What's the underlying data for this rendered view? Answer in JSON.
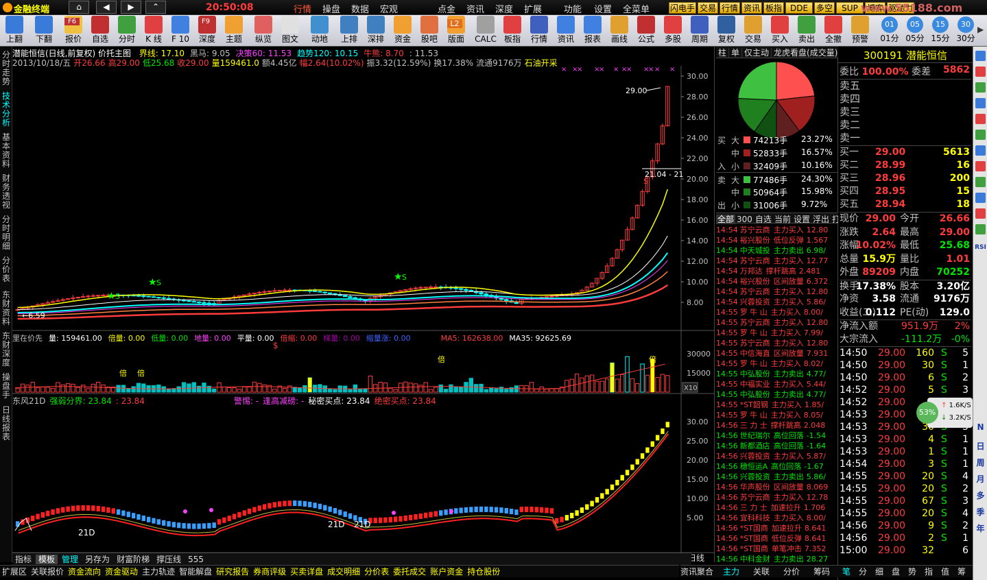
{
  "menubar": {
    "app_title": "金融终端",
    "clock": "20:50:08",
    "items": [
      "行情",
      "操盘",
      "数据",
      "宏观",
      "点金",
      "资讯",
      "深度",
      "扩展",
      "功能",
      "设置",
      "全菜单"
    ],
    "yellow_buttons": [
      "闪电手",
      "交易",
      "行情",
      "资讯",
      "板指",
      "DDE",
      "多空",
      "SUP",
      "博弈",
      "驱动力"
    ],
    "watermark": "www.55188.com"
  },
  "toolbar": {
    "buttons": [
      "上翻",
      "下翻",
      "报价",
      "自选",
      "分时",
      "K 线",
      "F 10",
      "深度",
      "主题",
      "纵览",
      "图文",
      "动地",
      "上排",
      "深排",
      "资金",
      "股吧",
      "版面",
      "CALC",
      "板指",
      "行情",
      "资讯",
      "报表",
      "画线",
      "公式",
      "多股",
      "周期",
      "复权",
      "交易",
      "买入",
      "卖出",
      "全撤",
      "预警"
    ],
    "periods": [
      "01",
      "05",
      "15",
      "30"
    ],
    "period_labels": [
      "01分",
      "05分",
      "15分",
      "30分"
    ],
    "f6": "F6",
    "f9": "F9",
    "l2": "L2"
  },
  "left_tabs": [
    "分时走势",
    "技术分析",
    "基本资料",
    "财务透视",
    "分时明细",
    "分价表",
    "东财资料",
    "东财深度",
    "操盘手",
    "日线报表"
  ],
  "chart": {
    "title": "潜能恒信(日线,前复权) 价托主图",
    "ma_labels": [
      {
        "label": "界线: 17.10",
        "color": "#ffff00"
      },
      {
        "label": "黑马: 9.05",
        "color": "#c0c0c0"
      },
      {
        "label": "决策60: 11.53",
        "color": "#ff40ff"
      },
      {
        "label": "趋势120: 10.15",
        "color": "#00ffff"
      },
      {
        "label": "牛熊: 8.70",
        "color": "#ff3c3c"
      },
      {
        "label": ": 11.53",
        "color": "#c0c0c0"
      }
    ],
    "info_line": [
      {
        "t": "2013/10/18/五",
        "c": "#c0c0c0"
      },
      {
        "t": "开26.66",
        "c": "#ff3c3c"
      },
      {
        "t": "高29.00",
        "c": "#ff3c3c"
      },
      {
        "t": "低25.68",
        "c": "#00e400"
      },
      {
        "t": "收29.00",
        "c": "#ff3c3c"
      },
      {
        "t": "量159461.0",
        "c": "#ffff00"
      },
      {
        "t": "额4.45亿",
        "c": "#c0c0c0"
      },
      {
        "t": "幅2.64(10.02%)",
        "c": "#ff3c3c"
      },
      {
        "t": "振3.32(12.59%)",
        "c": "#c0c0c0"
      },
      {
        "t": "换17.38%",
        "c": "#c0c0c0"
      },
      {
        "t": "流通9176万",
        "c": "#c0c0c0"
      },
      {
        "t": "石油开采",
        "c": "#ffff00"
      }
    ],
    "price_ticks": [
      "30.00",
      "28.00",
      "26.00",
      "24.00",
      "22.00",
      "20.00",
      "18.00",
      "16.00",
      "14.00",
      "12.00",
      "10.00",
      "8.00"
    ],
    "hi_label": "29.00",
    "lo_label": "6.59",
    "mid_label": "21.04 - 21",
    "s_marker": "S",
    "dollar_marker": "$",
    "volume_line": [
      {
        "t": "里在价先",
        "c": "#c0c0c0"
      },
      {
        "t": "量: 159461.00",
        "c": "#fff"
      },
      {
        "t": "倍量: 0.00",
        "c": "#ffff00"
      },
      {
        "t": "低量: 0.00",
        "c": "#00e400"
      },
      {
        "t": "地量: 0.00",
        "c": "#ff40ff"
      },
      {
        "t": "平量: 0.00",
        "c": "#fff"
      },
      {
        "t": "倍缩: 0.00",
        "c": "#ff3c3c"
      },
      {
        "t": "梯量: 0.00",
        "c": "#a000a0"
      },
      {
        "t": "缩量涨: 0.00",
        "c": "#4060ff"
      },
      {
        "t": "MA5: 162638.00",
        "c": "#ff3c3c"
      },
      {
        "t": "MA35: 92625.69",
        "c": "#fff"
      }
    ],
    "volume_ticks": [
      "30000",
      "15000"
    ],
    "x10": "X10",
    "vol_marker": "倍",
    "dongfeng_line": [
      {
        "t": "东风21D",
        "c": "#c0c0c0"
      },
      {
        "t": "强弱分界: 23.84",
        "c": "#00e400"
      },
      {
        "t": ": 23.84",
        "c": "#ff3c3c"
      },
      {
        "t": "警惕: -",
        "c": "#ff40ff"
      },
      {
        "t": "逢高减磅: -",
        "c": "#ff40ff"
      },
      {
        "t": "秘密买点: 23.84",
        "c": "#fff"
      },
      {
        "t": "绝密买点: 23.84",
        "c": "#ff3c3c"
      }
    ],
    "ind_ticks": [
      "30.00",
      "25.00",
      "20.00",
      "15.00",
      "10.00",
      "5.00"
    ],
    "ind_labels": [
      "21D",
      "21D",
      "21D"
    ],
    "xaxis": [
      "20",
      "5",
      "6",
      "7",
      "8",
      "9",
      "10"
    ],
    "date_box": "2013/04/02/二",
    "period_label": "日线"
  },
  "bottom_tabs1": [
    "指标",
    "模板",
    "管理",
    "另存为",
    "财富阶梯",
    "撑压线",
    "555"
  ],
  "bottom_tabs2": [
    "扩展区",
    "关联报价",
    "资金流向",
    "资金驱动",
    "主力轨迹",
    "智能解盘",
    "研究报告",
    "券商评级",
    "买卖详盘",
    "成交明细",
    "分价表",
    "委托成交",
    "账户资金",
    "持仓股份"
  ],
  "bottom_right_tab": "资讯聚合",
  "mid": {
    "tabs": [
      "柱",
      "单",
      "仅主动",
      "龙虎看盘(成交量)"
    ],
    "flow": [
      {
        "side": "买",
        "label": "大",
        "val": "74213手",
        "pct": "23.27%",
        "color": "#ff5050"
      },
      {
        "side": "",
        "label": "中",
        "val": "52833手",
        "pct": "16.57%",
        "color": "#a02020"
      },
      {
        "side": "入",
        "label": "小",
        "val": "32409手",
        "pct": "10.16%",
        "color": "#602020"
      },
      {
        "side": "卖",
        "label": "大",
        "val": "77486手",
        "pct": "24.30%",
        "color": "#40c040"
      },
      {
        "side": "",
        "label": "中",
        "val": "50964手",
        "pct": "15.98%",
        "color": "#208020"
      },
      {
        "side": "出",
        "label": "小",
        "val": "31006手",
        "pct": "9.72%",
        "color": "#105010"
      }
    ],
    "list_tabs": [
      "全部",
      "300",
      "自选",
      "当前",
      "设置",
      "浮出",
      "打"
    ],
    "rows": [
      {
        "time": "14:54",
        "name": "苏宁云商",
        "act": "主力买入",
        "v": "12.80"
      },
      {
        "time": "14:54",
        "name": "裕兴股份",
        "act": "低位反弹",
        "v": "1.567"
      },
      {
        "time": "14:54",
        "name": "中天城投",
        "act": "主力卖出",
        "v": "6.98/"
      },
      {
        "time": "14:54",
        "name": "苏宁云商",
        "act": "主力买入",
        "v": "12.77"
      },
      {
        "time": "14:54",
        "name": "万邦达",
        "act": "撑杆跳高",
        "v": "2.481"
      },
      {
        "time": "14:54",
        "name": "裕兴股份",
        "act": "区间放量",
        "v": "6.372"
      },
      {
        "time": "14:54",
        "name": "苏宁云商",
        "act": "主力买入",
        "v": "12.80"
      },
      {
        "time": "14:54",
        "name": "兴蓉投资",
        "act": "主力买入",
        "v": "5.86/"
      },
      {
        "time": "14:55",
        "name": "罗 牛 山",
        "act": "主力买入",
        "v": "8.00/"
      },
      {
        "time": "14:55",
        "name": "苏宁云商",
        "act": "主力买入",
        "v": "12.80"
      },
      {
        "time": "14:55",
        "name": "罗 牛 山",
        "act": "主力买入",
        "v": "7.99/"
      },
      {
        "time": "14:55",
        "name": "苏宁云商",
        "act": "主力买入",
        "v": "12.80"
      },
      {
        "time": "14:55",
        "name": "中信海直",
        "act": "区间放量",
        "v": "7.931"
      },
      {
        "time": "14:55",
        "name": "罗 牛 山",
        "act": "主力买入",
        "v": "8.02/"
      },
      {
        "time": "14:55",
        "name": "中弘股份",
        "act": "主力卖出",
        "v": "4.77/"
      },
      {
        "time": "14:55",
        "name": "中福实业",
        "act": "主力买入",
        "v": "5.44/"
      },
      {
        "time": "14:55",
        "name": "中弘股份",
        "act": "主力卖出",
        "v": "4.77/"
      },
      {
        "time": "14:55",
        "name": "*ST韶钢",
        "act": "主力买入",
        "v": "1.85/"
      },
      {
        "time": "14:55",
        "name": "罗 牛 山",
        "act": "主力买入",
        "v": "8.05/"
      },
      {
        "time": "14:56",
        "name": "三 力 士",
        "act": "撑杆跳高",
        "v": "2.048"
      },
      {
        "time": "14:56",
        "name": "世纪瑞尔",
        "act": "高位回落",
        "v": "-1.54"
      },
      {
        "time": "14:56",
        "name": "新都酒店",
        "act": "高位回落",
        "v": "-1.64"
      },
      {
        "time": "14:56",
        "name": "兴蓉投资",
        "act": "主力买入",
        "v": "5.87/"
      },
      {
        "time": "14:56",
        "name": "穗恒运A",
        "act": "高位回落",
        "v": "-1.67"
      },
      {
        "time": "14:56",
        "name": "兴蓉投资",
        "act": "主力卖出",
        "v": "5.86/"
      },
      {
        "time": "14:56",
        "name": "华声股份",
        "act": "区间放量",
        "v": "8.069"
      },
      {
        "time": "14:56",
        "name": "苏宁云商",
        "act": "主力买入",
        "v": "12.78"
      },
      {
        "time": "14:56",
        "name": "三 力 士",
        "act": "加速拉升",
        "v": "1.706"
      },
      {
        "time": "14:56",
        "name": "宜科科技",
        "act": "主力买入",
        "v": "8.00/"
      },
      {
        "time": "14:56",
        "name": "*ST国商",
        "act": "加速拉升",
        "v": "8.641"
      },
      {
        "time": "14:56",
        "name": "*ST国商",
        "act": "低位反弹",
        "v": "8.641"
      },
      {
        "time": "14:56",
        "name": "*ST国商",
        "act": "单笔冲击",
        "v": "7.352"
      },
      {
        "time": "14:56",
        "name": "中科金财",
        "act": "主力卖出",
        "v": "28.27"
      }
    ],
    "bottom_tabs": [
      "主力",
      "关联",
      "分价",
      "筹码"
    ]
  },
  "right": {
    "code": "300191",
    "name": "潜能恒信",
    "weibi_label": "委比",
    "weibi": "100.00%",
    "weicha_label": "委差",
    "weicha": "5862",
    "asks": [
      "卖五",
      "卖四",
      "卖三",
      "卖二",
      "卖一"
    ],
    "bids": [
      {
        "l": "买一",
        "p": "29.00",
        "v": "5613"
      },
      {
        "l": "买二",
        "p": "28.99",
        "v": "16"
      },
      {
        "l": "买三",
        "p": "28.96",
        "v": "200"
      },
      {
        "l": "买四",
        "p": "28.95",
        "v": "15"
      },
      {
        "l": "买五",
        "p": "28.94",
        "v": "18"
      }
    ],
    "quote": [
      {
        "l1": "现价",
        "v1": "29.00",
        "c1": "#ff3c3c",
        "l2": "今开",
        "v2": "26.66",
        "c2": "#ff3c3c"
      },
      {
        "l1": "涨跌",
        "v1": "2.64",
        "c1": "#ff3c3c",
        "l2": "最高",
        "v2": "29.00",
        "c2": "#ff3c3c"
      },
      {
        "l1": "涨幅",
        "v1": "10.02%",
        "c1": "#ff3c3c",
        "l2": "最低",
        "v2": "25.68",
        "c2": "#00e400"
      },
      {
        "l1": "总量",
        "v1": "15.9万",
        "c1": "#ffff00",
        "l2": "量比",
        "v2": "1.01",
        "c2": "#ff3c3c"
      },
      {
        "l1": "外盘",
        "v1": "89209",
        "c1": "#ff3c3c",
        "l2": "内盘",
        "v2": "70252",
        "c2": "#00e400"
      },
      {
        "l1": "换手",
        "v1": "17.38%",
        "c1": "#fff",
        "l2": "股本",
        "v2": "3.20亿",
        "c2": "#fff"
      },
      {
        "l1": "净资",
        "v1": "3.58",
        "c1": "#fff",
        "l2": "流通",
        "v2": "9176万",
        "c2": "#fff"
      },
      {
        "l1": "收益(二)",
        "v1": "0.112",
        "c1": "#fff",
        "l2": "PE(动)",
        "v2": "129.0",
        "c2": "#fff"
      }
    ],
    "net_label": "净流入额",
    "net_val": "951.9万",
    "net_pct": "2%",
    "big_label": "大宗流入",
    "big_val": "-111.2万",
    "big_pct": "-0%",
    "ticks": [
      {
        "t": "14:50",
        "p": "29.00",
        "v": "160",
        "s": "S",
        "n": "5"
      },
      {
        "t": "14:50",
        "p": "29.00",
        "v": "30",
        "s": "S",
        "n": "1"
      },
      {
        "t": "14:50",
        "p": "29.00",
        "v": "6",
        "s": "S",
        "n": "2"
      },
      {
        "t": "14:52",
        "p": "29.00",
        "v": "5",
        "s": "S",
        "n": "3"
      },
      {
        "t": "14:52",
        "p": "29.00",
        "v": "",
        "s": "",
        "n": ""
      },
      {
        "t": "14:53",
        "p": "29.00",
        "v": "",
        "s": "",
        "n": ""
      },
      {
        "t": "14:53",
        "p": "29.00",
        "v": "30",
        "s": "S",
        "n": "5"
      },
      {
        "t": "14:53",
        "p": "29.00",
        "v": "4",
        "s": "S",
        "n": "1"
      },
      {
        "t": "14:53",
        "p": "29.00",
        "v": "1",
        "s": "S",
        "n": "1"
      },
      {
        "t": "14:54",
        "p": "29.00",
        "v": "3",
        "s": "S",
        "n": "1"
      },
      {
        "t": "14:55",
        "p": "29.00",
        "v": "20",
        "s": "S",
        "n": "4"
      },
      {
        "t": "14:55",
        "p": "29.00",
        "v": "20",
        "s": "S",
        "n": "2"
      },
      {
        "t": "14:55",
        "p": "29.00",
        "v": "67",
        "s": "S",
        "n": "3"
      },
      {
        "t": "14:55",
        "p": "29.00",
        "v": "20",
        "s": "S",
        "n": "4"
      },
      {
        "t": "14:56",
        "p": "29.00",
        "v": "9",
        "s": "S",
        "n": "2"
      },
      {
        "t": "14:56",
        "p": "29.00",
        "v": "2",
        "s": "S",
        "n": "1"
      },
      {
        "t": "15:00",
        "p": "29.00",
        "v": "32",
        "s": "",
        "n": "6"
      }
    ],
    "speed_pct": "53%",
    "speed_up": "1.6K/S",
    "speed_down": "3.2K/S",
    "bottom_tabs": [
      "笔",
      "分",
      "细",
      "盘",
      "势",
      "指",
      "值",
      "筹"
    ]
  },
  "sidebar_right": [
    "RSI",
    "N",
    "日",
    "周",
    "月",
    "多",
    "季",
    "年"
  ]
}
